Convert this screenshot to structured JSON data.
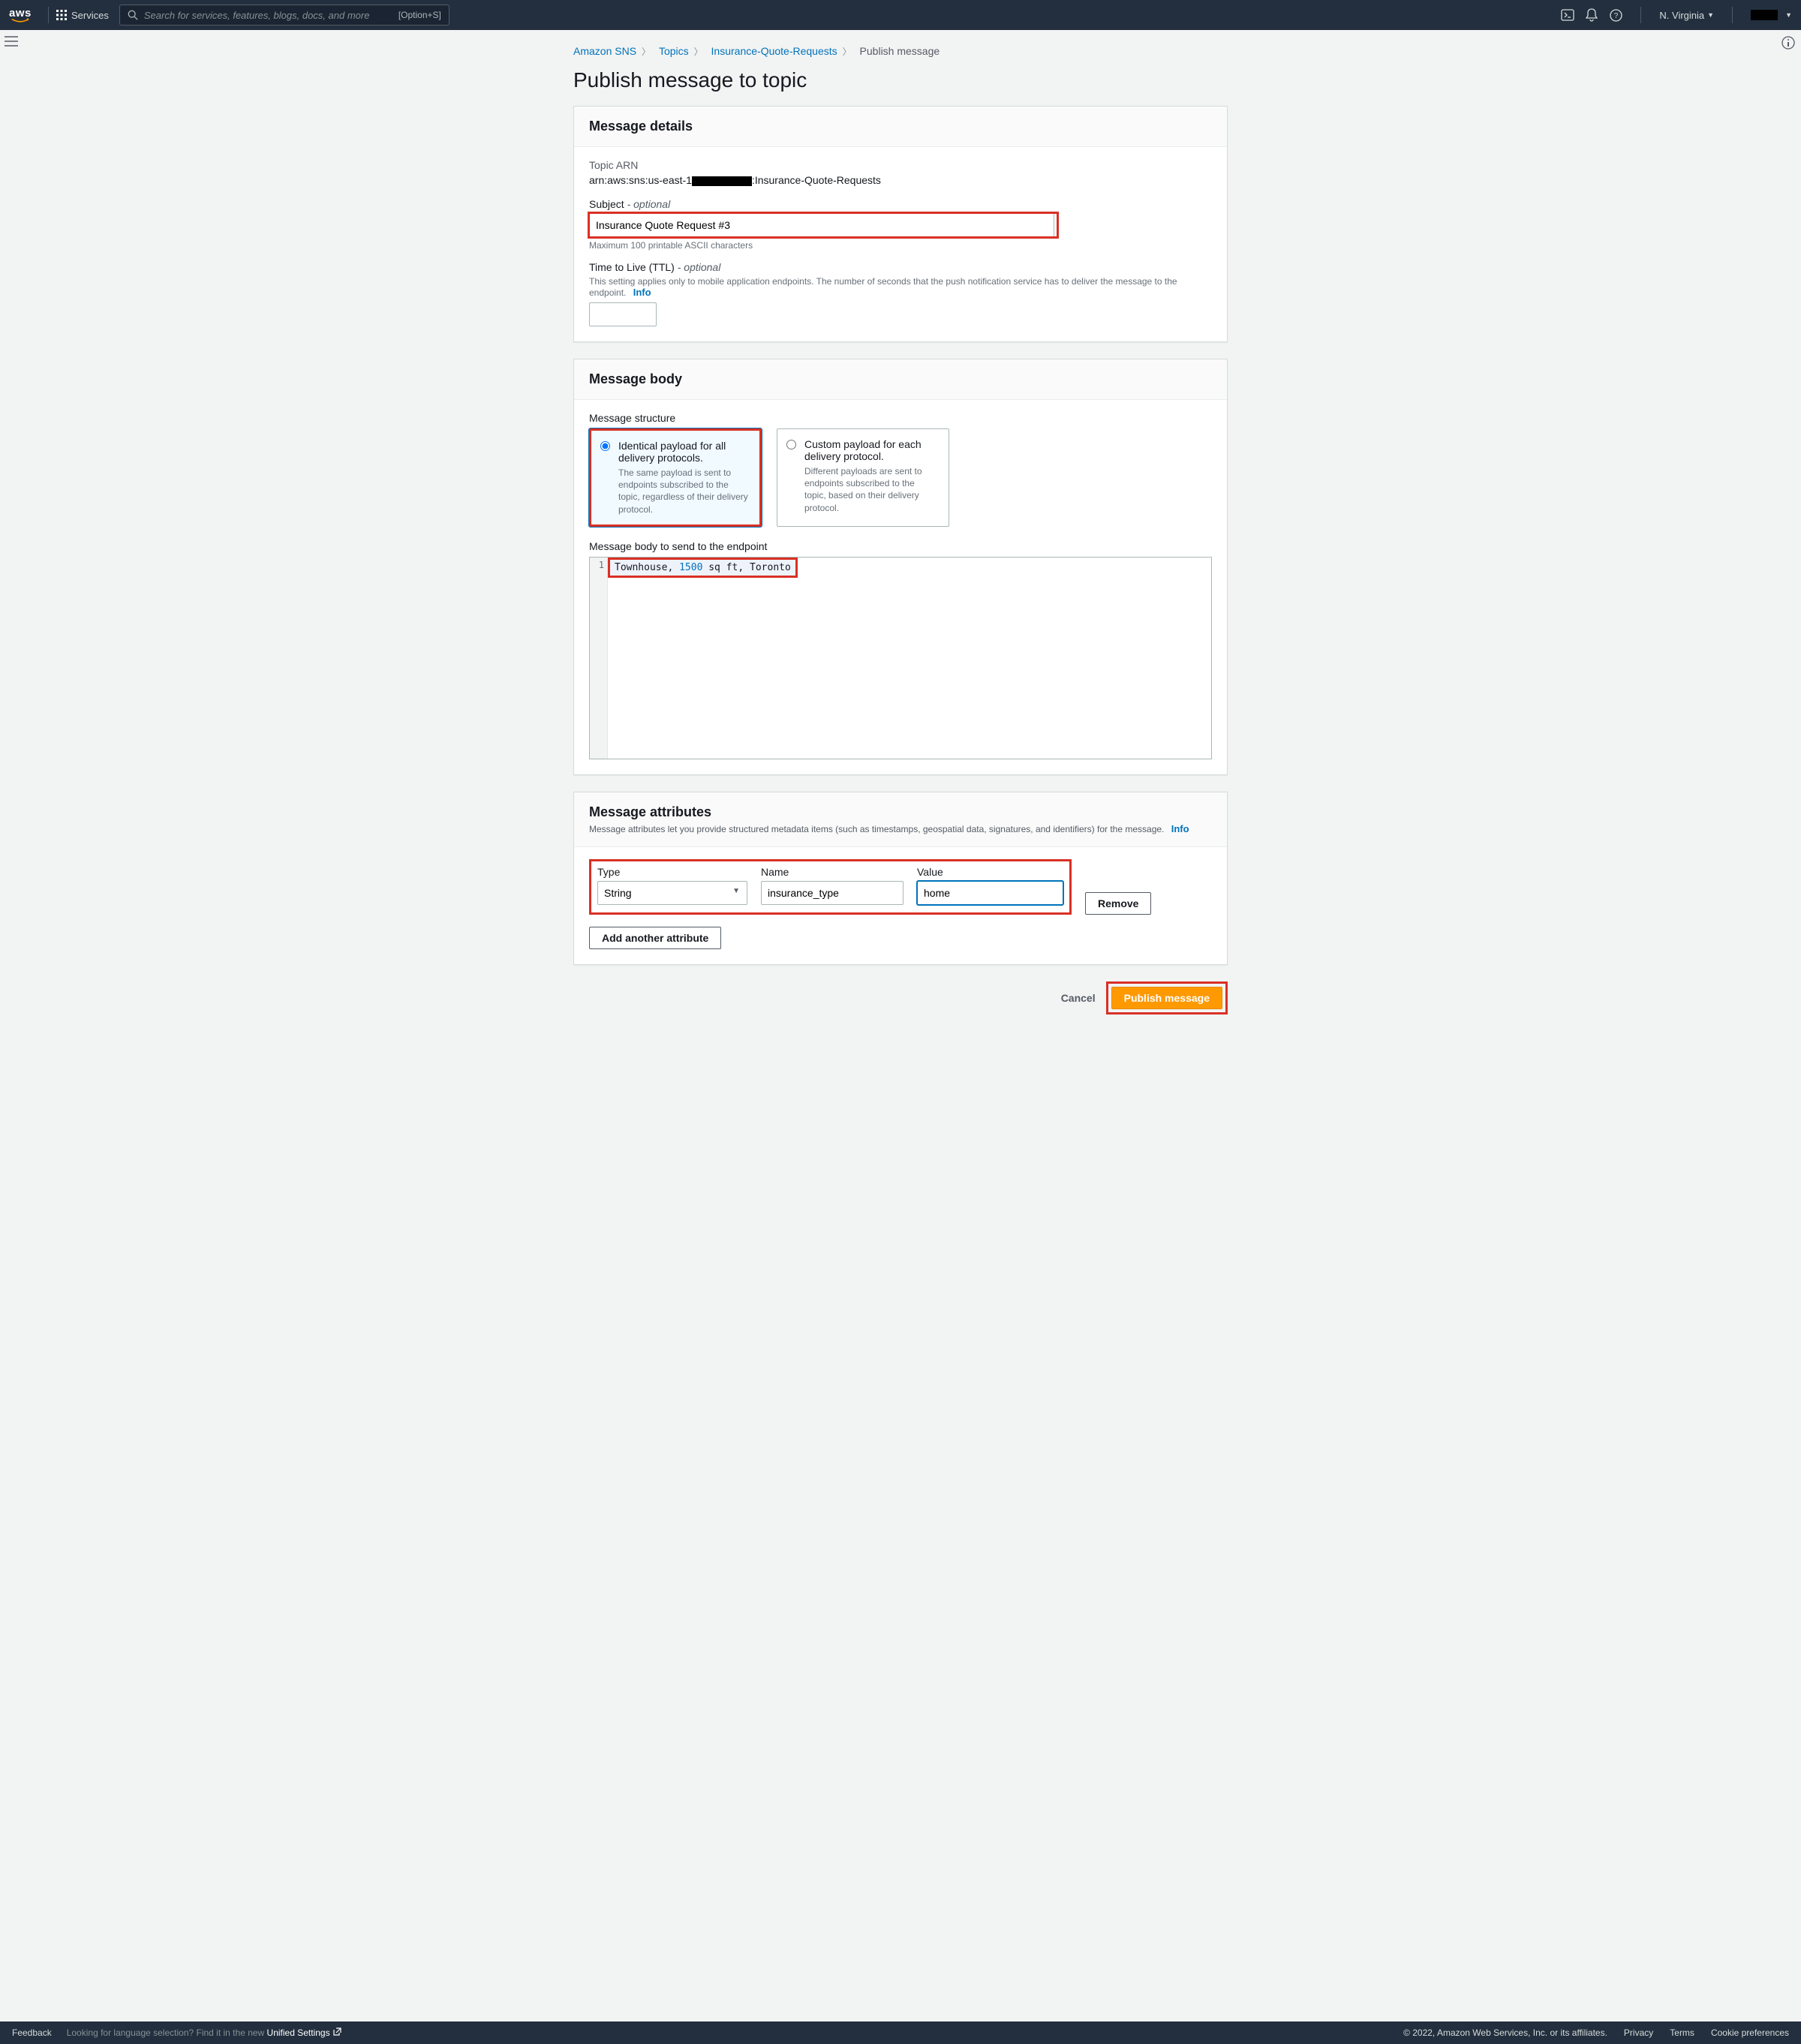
{
  "nav": {
    "services": "Services",
    "search_placeholder": "Search for services, features, blogs, docs, and more",
    "search_kbd": "[Option+S]",
    "region": "N. Virginia"
  },
  "breadcrumb": {
    "a": "Amazon SNS",
    "b": "Topics",
    "c": "Insurance-Quote-Requests",
    "d": "Publish message"
  },
  "title": "Publish message to topic",
  "details": {
    "heading": "Message details",
    "arn_label": "Topic ARN",
    "arn_prefix": "arn:aws:sns:us-east-1",
    "arn_suffix": ":Insurance-Quote-Requests",
    "subject_label": "Subject",
    "optional": " - optional",
    "subject_value": "Insurance Quote Request #3",
    "subject_hint": "Maximum 100 printable ASCII characters",
    "ttl_label": "Time to Live (TTL)",
    "ttl_hint": "This setting applies only to mobile application endpoints. The number of seconds that the push notification service has to deliver the message to the endpoint.",
    "info": "Info"
  },
  "body": {
    "heading": "Message body",
    "structure_label": "Message structure",
    "opt1_title": "Identical payload for all delivery protocols.",
    "opt1_desc": "The same payload is sent to endpoints subscribed to the topic, regardless of their delivery protocol.",
    "opt2_title": "Custom payload for each delivery protocol.",
    "opt2_desc": "Different payloads are sent to endpoints subscribed to the topic, based on their delivery protocol.",
    "editor_label": "Message body to send to the endpoint",
    "line_no": "1",
    "code_a": "Townhouse, ",
    "code_num": "1500",
    "code_b": " sq ft, Toronto"
  },
  "attrs": {
    "heading": "Message attributes",
    "desc": "Message attributes let you provide structured metadata items (such as timestamps, geospatial data, signatures, and identifiers) for the message.",
    "info": "Info",
    "type_label": "Type",
    "type_value": "String",
    "name_label": "Name",
    "name_value": "insurance_type",
    "value_label": "Value",
    "value_value": "home",
    "remove": "Remove",
    "add": "Add another attribute"
  },
  "actions": {
    "cancel": "Cancel",
    "publish": "Publish message"
  },
  "footer": {
    "feedback": "Feedback",
    "lang_a": "Looking for language selection? Find it in the new ",
    "lang_b": "Unified Settings",
    "copy": "© 2022, Amazon Web Services, Inc. or its affiliates.",
    "privacy": "Privacy",
    "terms": "Terms",
    "cookies": "Cookie preferences"
  }
}
